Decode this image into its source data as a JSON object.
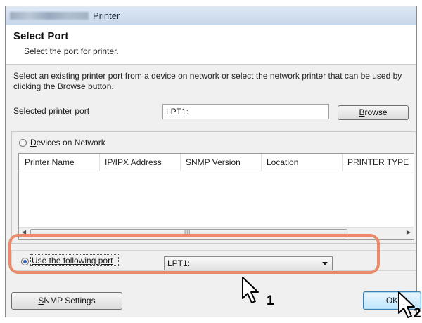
{
  "window": {
    "title": "Printer"
  },
  "header": {
    "title": "Select Port",
    "subtitle": "Select the port for printer."
  },
  "description": "Select an existing printer port from a device on network or select the network printer that can be used by clicking the Browse button.",
  "selected_port": {
    "label": "Selected printer port",
    "value": "LPT1:"
  },
  "browse_button": {
    "access_key": "B",
    "rest": "rowse"
  },
  "devices_radio": {
    "access_key": "D",
    "rest": "evices on Network",
    "checked": false
  },
  "table": {
    "columns": [
      "Printer Name",
      "IP/IPX Address",
      "SNMP Version",
      "Location",
      "PRINTER TYPE"
    ],
    "rows": []
  },
  "use_port_radio": {
    "access_key": "U",
    "rest": "se the following port",
    "checked": true
  },
  "port_combo": {
    "value": "LPT1:"
  },
  "snmp_button": {
    "access_key": "S",
    "rest": "NMP Settings"
  },
  "ok_button": {
    "label": "OK"
  },
  "callouts": {
    "step1": "1",
    "step2": "2"
  },
  "colors": {
    "highlight": "#e98b6a",
    "ok_border": "#3c7fb1"
  }
}
